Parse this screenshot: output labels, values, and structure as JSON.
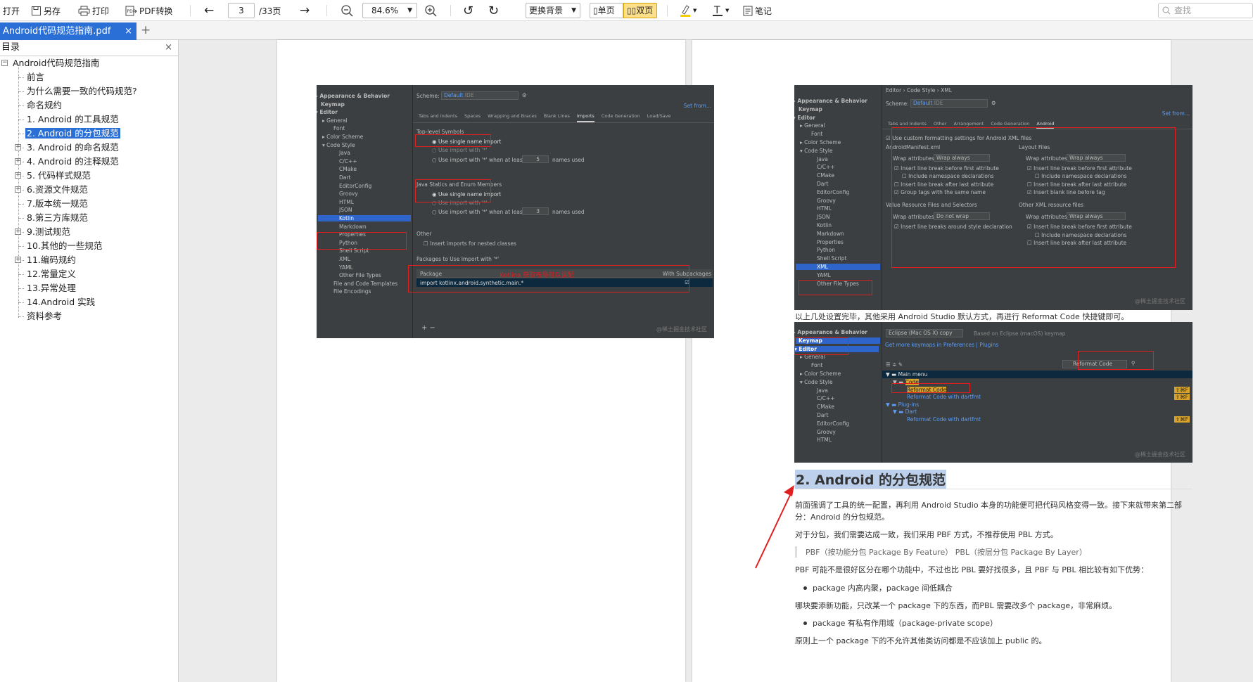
{
  "toolbar": {
    "open": "打开",
    "save_as": "另存",
    "print": "打印",
    "pdf_convert": "PDF转换",
    "page_current": "3",
    "page_total": "/33页",
    "zoom": "84.6%",
    "change_bg": "更换背景",
    "single_page": "单页",
    "double_page": "双页",
    "notes": "笔记",
    "search_placeholder": "查找"
  },
  "tabs": [
    {
      "label": "Android代码规范指南.pdf"
    }
  ],
  "sidebar": {
    "title": "目录",
    "root": "Android代码规范指南",
    "items": [
      {
        "label": "前言"
      },
      {
        "label": "为什么需要一致的代码规范?"
      },
      {
        "label": "命名规约"
      },
      {
        "label": "1. Android 的工具规范"
      },
      {
        "label": "2. Android 的分包规范"
      },
      {
        "label": "3. Android 的命名规范"
      },
      {
        "label": "4. Android 的注释规范"
      },
      {
        "label": "5. 代码样式规范"
      },
      {
        "label": "6.资源文件规范"
      },
      {
        "label": "7.版本统一规范"
      },
      {
        "label": "8.第三方库规范"
      },
      {
        "label": "9.测试规范"
      },
      {
        "label": "10.其他的一些规范"
      },
      {
        "label": "11.编码规约"
      },
      {
        "label": "12.常量定义"
      },
      {
        "label": "13.异常处理"
      },
      {
        "label": "14.Android 实践"
      },
      {
        "label": "资料参考"
      }
    ]
  },
  "left_shot": {
    "sidebar_items": [
      "Appearance & Behavior",
      "Keymap",
      "Editor",
      "General",
      "Font",
      "Color Scheme",
      "Code Style",
      "Java",
      "C/C++",
      "CMake",
      "Dart",
      "EditorConfig",
      "Groovy",
      "HTML",
      "JSON",
      "Kotlin",
      "Markdown",
      "Properties",
      "Python",
      "Shell Script",
      "XML",
      "YAML",
      "Other File Types",
      "File and Code Templates",
      "File Encodings"
    ],
    "scheme_label": "Scheme:",
    "scheme_value": "Default",
    "scheme_sub": "IDE",
    "set_from": "Set from...",
    "tabs": [
      "Tabs and Indents",
      "Spaces",
      "Wrapping and Braces",
      "Blank Lines",
      "Imports",
      "Code Generation",
      "Load/Save"
    ],
    "top_level": "Top-level Symbols",
    "opt_single": "Use single name import",
    "opt_star": "Use import with '*'",
    "opt_star_at": "Use import with '*' when at least",
    "names_used": "names used",
    "num5": "5",
    "num3": "3",
    "java_statics": "Java Statics and Enum Members",
    "other": "Other",
    "nested": "Insert imports for nested classes",
    "packages": "Packages to Use Import with '*'",
    "col_package": "Package",
    "col_sub": "With Subpackages",
    "pkg_row": "import kotlinx.android.synthetic.main.*",
    "annotation": "Kotlinx 获取布局可以调配",
    "watermark": "@稀土掘金技术社区"
  },
  "right_shot1": {
    "breadcrumb": "Editor  ›  Code Style  ›  XML",
    "sidebar_items": [
      "Appearance & Behavior",
      "Keymap",
      "Editor",
      "General",
      "Font",
      "Color Scheme",
      "Code Style",
      "Java",
      "C/C++",
      "CMake",
      "Dart",
      "EditorConfig",
      "Groovy",
      "HTML",
      "JSON",
      "Kotlin",
      "Markdown",
      "Properties",
      "Python",
      "Shell Script",
      "XML",
      "YAML",
      "Other File Types"
    ],
    "scheme_label": "Scheme:",
    "scheme_value": "Default",
    "scheme_sub": "IDE",
    "set_from": "Set from...",
    "tabs": [
      "Tabs and Indents",
      "Other",
      "Arrangement",
      "Code Generation",
      "Android"
    ],
    "custom": "Use custom formatting settings for Android XML files",
    "manifest": "AndroidManifest.xml",
    "layout": "Layout Files",
    "wrap_attr": "Wrap attributes:",
    "wrap_always": "Wrap always",
    "do_not_wrap": "Do not wrap",
    "ins_first": "Insert line break before first attribute",
    "incl_ns": "Include namespace declarations",
    "ins_last": "Insert line break after last attribute",
    "group_tags": "Group tags with the same name",
    "blank_before": "Insert blank line before tag",
    "value_res": "Value Resource Files and Selectors",
    "other_xml": "Other XML resource files",
    "ins_around": "Insert line breaks around style declaration",
    "watermark": "@稀土掘金技术社区"
  },
  "caption": "以上几处设置完毕，其他采用 Android Studio 默认方式，再进行 Reformat Code 快捷键即可。",
  "right_shot2": {
    "sidebar_items": [
      "Appearance & Behavior",
      "Keymap",
      "Editor",
      "General",
      "Font",
      "Color Scheme",
      "Code Style",
      "Java",
      "C/C++",
      "CMake",
      "Dart",
      "EditorConfig",
      "Groovy",
      "HTML"
    ],
    "keymap_value": "Eclipse (Mac OS X) copy",
    "based_on": "Based on Eclipse (macOS) keymap",
    "more_keymaps": "Get more keymaps in Preferences | Plugins",
    "search": "Reformat Code",
    "tree": [
      "Main menu",
      "Code",
      "Reformat Code",
      "Reformat Code with dartfmt",
      "Plug-ins",
      "Dart",
      "Reformat Code with dartfmt"
    ],
    "shortcut": "⇧⌘F",
    "watermark": "@稀土掘金技术社区"
  },
  "article": {
    "heading": "2. Android 的分包规范",
    "p1a": "前面强调了工具的统一配置，再利用 Android Studio 本身的功能便可把代码风格变得一致。接下来就带来第二部",
    "p1b": "分：Android 的分包规范。",
    "p2": "对于分包，我们需要达成一致，我们采用 PBF 方式，不推荐使用 PBL 方式。",
    "quote": "PBF（按功能分包 Package By Feature） PBL（按层分包 Package By Layer）",
    "p3": "PBF 可能不是很好区分在哪个功能中，不过也比 PBL 要好找很多，且 PBF 与 PBL 相比较有如下优势：",
    "li1": "package 内高内聚，package 间低耦合",
    "p4": "哪块要添新功能，只改某一个 package 下的东西，而PBL 需要改多个 package，非常麻烦。",
    "li2": "package 有私有作用域（package-private scope）",
    "p5": "原则上一个 package 下的不允许其他类访问都是不应该加上 public 的。"
  },
  "colors": {
    "accent": "#2a6fd6",
    "annotation_red": "#e02020",
    "ide_bg": "#3c3f41",
    "ide_selection": "#2f65ca"
  }
}
